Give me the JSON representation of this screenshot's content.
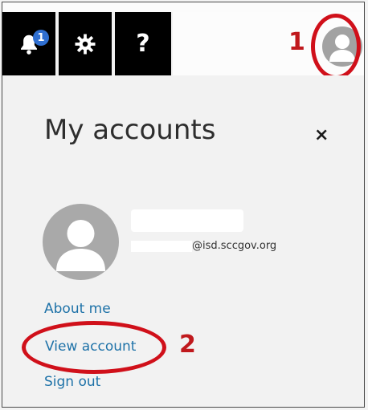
{
  "topbar": {
    "notification_badge": "1",
    "help_label": "?",
    "icons": [
      "bell-icon",
      "gear-icon",
      "help-icon"
    ]
  },
  "annotations": {
    "step1": "1",
    "step2": "2",
    "highlight_color": "#d0101a"
  },
  "panel": {
    "title": "My accounts",
    "close_label": "×",
    "email_domain": "@isd.sccgov.org",
    "links": {
      "about": "About me",
      "view": "View account",
      "signout": "Sign out"
    }
  },
  "colors": {
    "link": "#1e72a8",
    "topbar": "#000000",
    "avatar": "#a9a9a9"
  }
}
